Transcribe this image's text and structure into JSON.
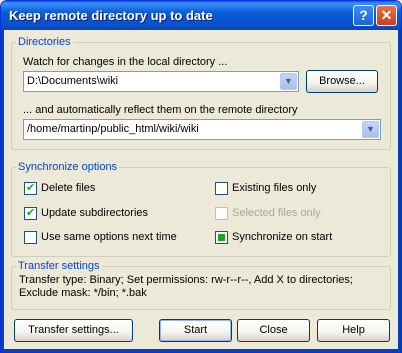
{
  "window": {
    "title": "Keep remote directory up to date",
    "help_icon": "question-icon",
    "close_icon": "close-icon"
  },
  "directories": {
    "legend": "Directories",
    "local_label": "Watch for changes in the local directory ...",
    "local_value": "D:\\Documents\\wiki",
    "browse_label": "Browse...",
    "remote_label": "... and automatically reflect them on the remote directory",
    "remote_value": "/home/martinp/public_html/wiki/wiki"
  },
  "sync": {
    "legend": "Synchronize options",
    "options": [
      {
        "label": "Delete files",
        "checked": true
      },
      {
        "label": "Existing files only",
        "checked": false
      },
      {
        "label": "Update subdirectories",
        "checked": true
      },
      {
        "label": "Selected files only",
        "checked": false,
        "disabled": true
      },
      {
        "label": "Use same options next time",
        "checked": false
      },
      {
        "label": "Synchronize on start",
        "checked": true
      }
    ]
  },
  "transfer": {
    "legend": "Transfer settings",
    "text": "Transfer type: Binary; Set permissions: rw-r--r--, Add X to directories; Exclude mask: */bin; *.bak"
  },
  "buttons": {
    "transfer_settings": "Transfer settings...",
    "start": "Start",
    "close": "Close",
    "help": "Help"
  }
}
